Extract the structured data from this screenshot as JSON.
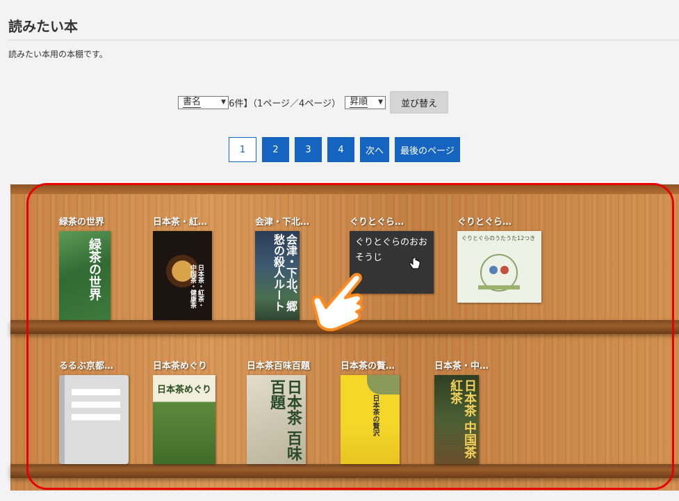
{
  "page": {
    "title": "読みたい本",
    "description": "読みたい本用の本棚です。"
  },
  "sort": {
    "count_text": "登録件数【36件】（1ページ／4ページ）",
    "field_value": "書名",
    "order_value": "昇順",
    "button_label": "並び替え"
  },
  "pagination": {
    "current": "1",
    "pages": [
      "2",
      "3",
      "4"
    ],
    "next": "次へ",
    "last": "最後のページ"
  },
  "shelf": {
    "row1": [
      {
        "title": "緑茶の世界",
        "cover_text": "緑茶の世界"
      },
      {
        "title": "日本茶・紅…",
        "cover_text": "日本茶・紅茶・中国茶・健康茶"
      },
      {
        "title": "会津・下北…",
        "cover_text": "会津・下北、郷愁の殺人ルート"
      },
      {
        "title": "ぐりとぐら…",
        "hover_text": "ぐりとぐらのおおそうじ"
      },
      {
        "title": "ぐりとぐら…",
        "cover_text": "ぐりとぐらのうたうた12つき"
      }
    ],
    "row2": [
      {
        "title": "るるぶ京都…"
      },
      {
        "title": "日本茶めぐり",
        "cover_text": "日本茶めぐり"
      },
      {
        "title": "日本茶百味百題",
        "cover_text": "日本茶 百味百題"
      },
      {
        "title": "日本茶の贅…",
        "cover_text": "日本茶の贅沢"
      },
      {
        "title": "日本茶・中…",
        "cover_text": "日本茶 中国茶 紅茶"
      }
    ]
  },
  "colors": {
    "accent": "#1565c0",
    "highlight": "#e60000"
  }
}
